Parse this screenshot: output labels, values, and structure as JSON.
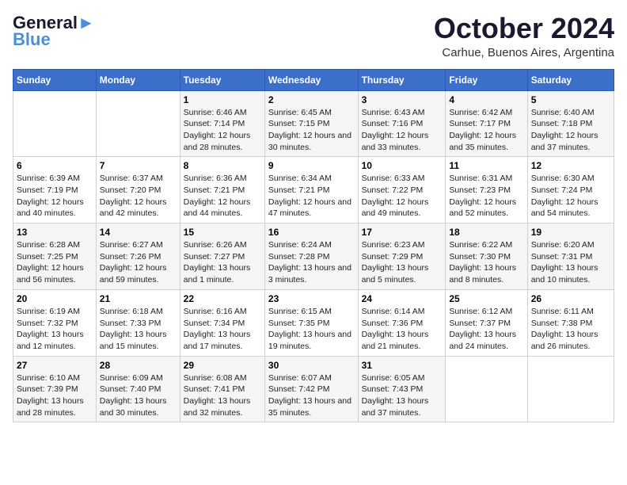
{
  "logo": {
    "line1": "General",
    "line2": "Blue"
  },
  "header": {
    "month": "October 2024",
    "location": "Carhue, Buenos Aires, Argentina"
  },
  "days_of_week": [
    "Sunday",
    "Monday",
    "Tuesday",
    "Wednesday",
    "Thursday",
    "Friday",
    "Saturday"
  ],
  "weeks": [
    [
      {
        "day": "",
        "sunrise": "",
        "sunset": "",
        "daylight": ""
      },
      {
        "day": "",
        "sunrise": "",
        "sunset": "",
        "daylight": ""
      },
      {
        "day": "1",
        "sunrise": "Sunrise: 6:46 AM",
        "sunset": "Sunset: 7:14 PM",
        "daylight": "Daylight: 12 hours and 28 minutes."
      },
      {
        "day": "2",
        "sunrise": "Sunrise: 6:45 AM",
        "sunset": "Sunset: 7:15 PM",
        "daylight": "Daylight: 12 hours and 30 minutes."
      },
      {
        "day": "3",
        "sunrise": "Sunrise: 6:43 AM",
        "sunset": "Sunset: 7:16 PM",
        "daylight": "Daylight: 12 hours and 33 minutes."
      },
      {
        "day": "4",
        "sunrise": "Sunrise: 6:42 AM",
        "sunset": "Sunset: 7:17 PM",
        "daylight": "Daylight: 12 hours and 35 minutes."
      },
      {
        "day": "5",
        "sunrise": "Sunrise: 6:40 AM",
        "sunset": "Sunset: 7:18 PM",
        "daylight": "Daylight: 12 hours and 37 minutes."
      }
    ],
    [
      {
        "day": "6",
        "sunrise": "Sunrise: 6:39 AM",
        "sunset": "Sunset: 7:19 PM",
        "daylight": "Daylight: 12 hours and 40 minutes."
      },
      {
        "day": "7",
        "sunrise": "Sunrise: 6:37 AM",
        "sunset": "Sunset: 7:20 PM",
        "daylight": "Daylight: 12 hours and 42 minutes."
      },
      {
        "day": "8",
        "sunrise": "Sunrise: 6:36 AM",
        "sunset": "Sunset: 7:21 PM",
        "daylight": "Daylight: 12 hours and 44 minutes."
      },
      {
        "day": "9",
        "sunrise": "Sunrise: 6:34 AM",
        "sunset": "Sunset: 7:21 PM",
        "daylight": "Daylight: 12 hours and 47 minutes."
      },
      {
        "day": "10",
        "sunrise": "Sunrise: 6:33 AM",
        "sunset": "Sunset: 7:22 PM",
        "daylight": "Daylight: 12 hours and 49 minutes."
      },
      {
        "day": "11",
        "sunrise": "Sunrise: 6:31 AM",
        "sunset": "Sunset: 7:23 PM",
        "daylight": "Daylight: 12 hours and 52 minutes."
      },
      {
        "day": "12",
        "sunrise": "Sunrise: 6:30 AM",
        "sunset": "Sunset: 7:24 PM",
        "daylight": "Daylight: 12 hours and 54 minutes."
      }
    ],
    [
      {
        "day": "13",
        "sunrise": "Sunrise: 6:28 AM",
        "sunset": "Sunset: 7:25 PM",
        "daylight": "Daylight: 12 hours and 56 minutes."
      },
      {
        "day": "14",
        "sunrise": "Sunrise: 6:27 AM",
        "sunset": "Sunset: 7:26 PM",
        "daylight": "Daylight: 12 hours and 59 minutes."
      },
      {
        "day": "15",
        "sunrise": "Sunrise: 6:26 AM",
        "sunset": "Sunset: 7:27 PM",
        "daylight": "Daylight: 13 hours and 1 minute."
      },
      {
        "day": "16",
        "sunrise": "Sunrise: 6:24 AM",
        "sunset": "Sunset: 7:28 PM",
        "daylight": "Daylight: 13 hours and 3 minutes."
      },
      {
        "day": "17",
        "sunrise": "Sunrise: 6:23 AM",
        "sunset": "Sunset: 7:29 PM",
        "daylight": "Daylight: 13 hours and 5 minutes."
      },
      {
        "day": "18",
        "sunrise": "Sunrise: 6:22 AM",
        "sunset": "Sunset: 7:30 PM",
        "daylight": "Daylight: 13 hours and 8 minutes."
      },
      {
        "day": "19",
        "sunrise": "Sunrise: 6:20 AM",
        "sunset": "Sunset: 7:31 PM",
        "daylight": "Daylight: 13 hours and 10 minutes."
      }
    ],
    [
      {
        "day": "20",
        "sunrise": "Sunrise: 6:19 AM",
        "sunset": "Sunset: 7:32 PM",
        "daylight": "Daylight: 13 hours and 12 minutes."
      },
      {
        "day": "21",
        "sunrise": "Sunrise: 6:18 AM",
        "sunset": "Sunset: 7:33 PM",
        "daylight": "Daylight: 13 hours and 15 minutes."
      },
      {
        "day": "22",
        "sunrise": "Sunrise: 6:16 AM",
        "sunset": "Sunset: 7:34 PM",
        "daylight": "Daylight: 13 hours and 17 minutes."
      },
      {
        "day": "23",
        "sunrise": "Sunrise: 6:15 AM",
        "sunset": "Sunset: 7:35 PM",
        "daylight": "Daylight: 13 hours and 19 minutes."
      },
      {
        "day": "24",
        "sunrise": "Sunrise: 6:14 AM",
        "sunset": "Sunset: 7:36 PM",
        "daylight": "Daylight: 13 hours and 21 minutes."
      },
      {
        "day": "25",
        "sunrise": "Sunrise: 6:12 AM",
        "sunset": "Sunset: 7:37 PM",
        "daylight": "Daylight: 13 hours and 24 minutes."
      },
      {
        "day": "26",
        "sunrise": "Sunrise: 6:11 AM",
        "sunset": "Sunset: 7:38 PM",
        "daylight": "Daylight: 13 hours and 26 minutes."
      }
    ],
    [
      {
        "day": "27",
        "sunrise": "Sunrise: 6:10 AM",
        "sunset": "Sunset: 7:39 PM",
        "daylight": "Daylight: 13 hours and 28 minutes."
      },
      {
        "day": "28",
        "sunrise": "Sunrise: 6:09 AM",
        "sunset": "Sunset: 7:40 PM",
        "daylight": "Daylight: 13 hours and 30 minutes."
      },
      {
        "day": "29",
        "sunrise": "Sunrise: 6:08 AM",
        "sunset": "Sunset: 7:41 PM",
        "daylight": "Daylight: 13 hours and 32 minutes."
      },
      {
        "day": "30",
        "sunrise": "Sunrise: 6:07 AM",
        "sunset": "Sunset: 7:42 PM",
        "daylight": "Daylight: 13 hours and 35 minutes."
      },
      {
        "day": "31",
        "sunrise": "Sunrise: 6:05 AM",
        "sunset": "Sunset: 7:43 PM",
        "daylight": "Daylight: 13 hours and 37 minutes."
      },
      {
        "day": "",
        "sunrise": "",
        "sunset": "",
        "daylight": ""
      },
      {
        "day": "",
        "sunrise": "",
        "sunset": "",
        "daylight": ""
      }
    ]
  ]
}
